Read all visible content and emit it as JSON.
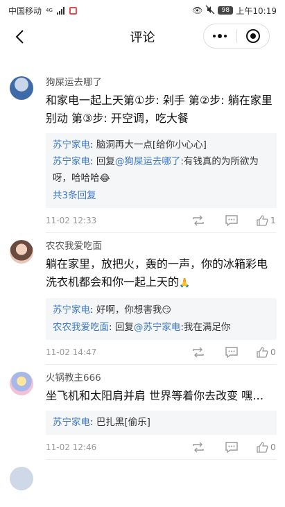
{
  "status_bar": {
    "carrier": "中国移动",
    "network": "4G",
    "battery": "98",
    "time": "上午10:19"
  },
  "nav": {
    "title": "评论"
  },
  "comments": [
    {
      "user": "狗屎运去哪了",
      "content": "和家电一起上天第①步: 剁手 第②步: 躺在家里别动 第③步: 开空调，吃大餐",
      "replies": [
        {
          "name": "苏宁家电",
          "text": ": 脑洞再大一点[给你小心心]"
        },
        {
          "name": "苏宁家电",
          "text": ": 回复",
          "mention": "@狗屎运去哪了",
          "text2": ":有钱真的为所欲为呀，哈哈哈",
          "emoji": "😂"
        }
      ],
      "expand_label": "共3条回复",
      "time": "11-02 12:33",
      "likes": "1"
    },
    {
      "user": "农农我爱吃面",
      "content": "躺在家里，放把火，轰的一声，你的冰箱彩电洗衣机都会和你一起上天的",
      "content_emoji": "🙏",
      "replies": [
        {
          "name": "苏宁家电",
          "text": ": 好啊，你想害我",
          "emoji": "😏"
        },
        {
          "name": "农农我爱吃面",
          "text": ": 回复",
          "mention": "@苏宁家电",
          "text2": ":我在满足你"
        }
      ],
      "time": "11-02 14:47",
      "likes": "0"
    },
    {
      "user": "火锅教主666",
      "content": "坐飞机和太阳肩并肩 世界等着你去改变 嘿…",
      "replies": [
        {
          "name": "苏宁家电",
          "text": ": 巴扎黑[偷乐]"
        }
      ],
      "time": "11-02 12:46",
      "likes": "0"
    }
  ]
}
